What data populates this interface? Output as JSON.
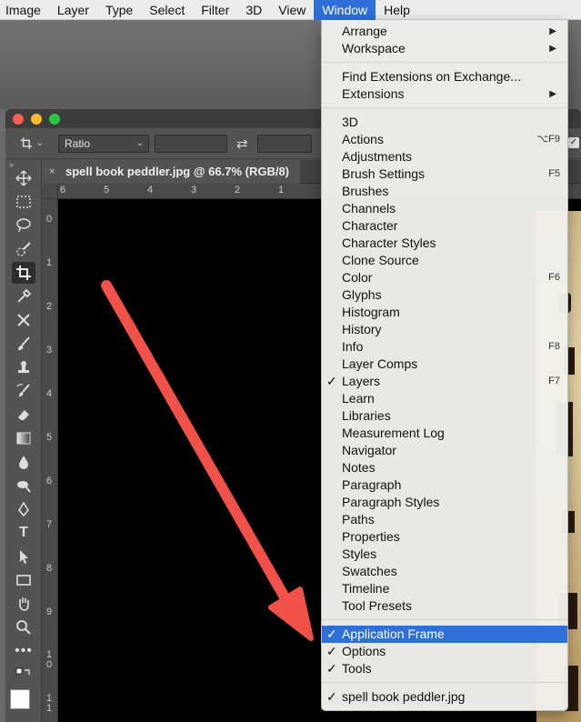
{
  "menubar": {
    "items": [
      "Image",
      "Layer",
      "Type",
      "Select",
      "Filter",
      "3D",
      "View",
      "Window",
      "Help"
    ],
    "active": "Window"
  },
  "window_menu": {
    "items": [
      {
        "label": "Arrange",
        "submenu": true
      },
      {
        "label": "Workspace",
        "submenu": true
      },
      {
        "label": "Find Extensions on Exchange..."
      },
      {
        "label": "Extensions",
        "submenu": true
      },
      {
        "label": "3D"
      },
      {
        "label": "Actions",
        "shortcut": "⌥F9"
      },
      {
        "label": "Adjustments"
      },
      {
        "label": "Brush Settings",
        "shortcut": "F5"
      },
      {
        "label": "Brushes"
      },
      {
        "label": "Channels"
      },
      {
        "label": "Character"
      },
      {
        "label": "Character Styles"
      },
      {
        "label": "Clone Source"
      },
      {
        "label": "Color",
        "shortcut": "F6"
      },
      {
        "label": "Glyphs"
      },
      {
        "label": "Histogram"
      },
      {
        "label": "History"
      },
      {
        "label": "Info",
        "shortcut": "F8"
      },
      {
        "label": "Layer Comps"
      },
      {
        "label": "Layers",
        "shortcut": "F7",
        "checked": true
      },
      {
        "label": "Learn"
      },
      {
        "label": "Libraries"
      },
      {
        "label": "Measurement Log"
      },
      {
        "label": "Navigator"
      },
      {
        "label": "Notes"
      },
      {
        "label": "Paragraph"
      },
      {
        "label": "Paragraph Styles"
      },
      {
        "label": "Paths"
      },
      {
        "label": "Properties"
      },
      {
        "label": "Styles"
      },
      {
        "label": "Swatches"
      },
      {
        "label": "Timeline"
      },
      {
        "label": "Tool Presets"
      },
      {
        "label": "Application Frame",
        "checked": true,
        "highlighted": true
      },
      {
        "label": "Options",
        "checked": true
      },
      {
        "label": "Tools",
        "checked": true
      },
      {
        "label": "spell book peddler.jpg",
        "checked": true
      }
    ]
  },
  "options_bar": {
    "ratio_label": "Ratio"
  },
  "document": {
    "tab_title": "spell book peddler.jpg @ 66.7% (RGB/8)",
    "close_glyph": "×"
  },
  "rulers": {
    "top_ticks": [
      "6",
      "5",
      "4",
      "3",
      "2",
      "1"
    ],
    "left_ticks": [
      "0",
      "1",
      "2",
      "3",
      "4",
      "5",
      "6",
      "7",
      "8",
      "9",
      "1 0",
      "1 1"
    ]
  },
  "colors": {
    "accent": "#2f6fd9",
    "arrow": "#f0524a"
  },
  "icons": [
    "move-icon",
    "marquee-icon",
    "lasso-icon",
    "quick-select-icon",
    "crop-icon",
    "eyedropper-icon",
    "healing-icon",
    "brush-icon",
    "stamp-icon",
    "history-brush-icon",
    "eraser-icon",
    "gradient-icon",
    "blur-icon",
    "dodge-icon",
    "pen-icon",
    "type-icon",
    "path-select-icon",
    "rectangle-icon",
    "hand-icon",
    "zoom-icon",
    "more-icon",
    "swap-colors-icon"
  ]
}
